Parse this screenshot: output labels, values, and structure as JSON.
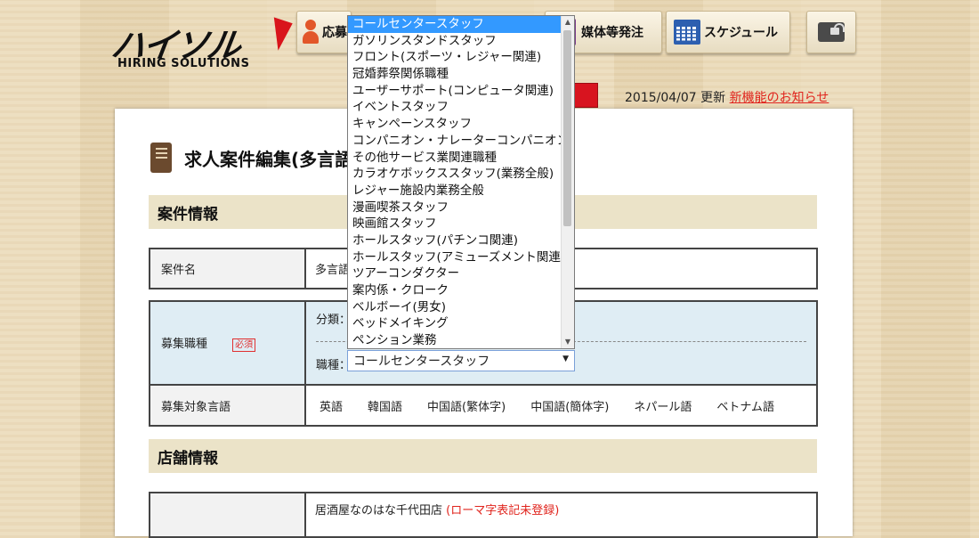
{
  "header": {
    "logo_jp": "ハイソル",
    "logo_en": "HIRING SOLUTIONS",
    "nav": {
      "oubo_label": "応募",
      "baitai_label": "媒体等発注",
      "schedule_label": "スケジュール"
    },
    "update_date": "2015/04/07 更新",
    "news_link": "新機能のお知らせ"
  },
  "page": {
    "title": "求人案件編集(多言語"
  },
  "section_case": {
    "heading": "案件情報",
    "case_name_label": "案件名",
    "case_name_value": "多言語",
    "job_type_label": "募集職種",
    "required_badge": "必須",
    "category_label": "分類：",
    "occupation_label": "職種：",
    "target_lang_label": "募集対象言語",
    "languages": [
      "英語",
      "韓国語",
      "中国語(繁体字)",
      "中国語(簡体字)",
      "ネパール語",
      "ベトナム語"
    ]
  },
  "select": {
    "value": "コールセンタースタッフ",
    "options": [
      "コールセンタースタッフ",
      "ガソリンスタンドスタッフ",
      "フロント(スポーツ・レジャー関連)",
      "冠婚葬祭関係職種",
      "ユーザーサポート(コンピュータ関連)",
      "イベントスタッフ",
      "キャンペーンスタッフ",
      "コンパニオン・ナレーターコンパニオン",
      "その他サービス業関連職種",
      "カラオケボックススタッフ(業務全般)",
      "レジャー施設内業務全般",
      "漫画喫茶スタッフ",
      "映画館スタッフ",
      "ホールスタッフ(パチンコ関連)",
      "ホールスタッフ(アミューズメント関連)",
      "ツアーコンダクター",
      "案内係・クローク",
      "ベルボーイ(男女)",
      "ベッドメイキング",
      "ペンション業務"
    ]
  },
  "section_store": {
    "heading": "店舗情報",
    "store_name": "居酒屋なのはな千代田店",
    "store_note": "(ローマ字表記未登録)"
  },
  "colors": {
    "accent_red": "#d8141f",
    "selected_option": "#3399ff",
    "section_bar": "#ebe3c8"
  }
}
